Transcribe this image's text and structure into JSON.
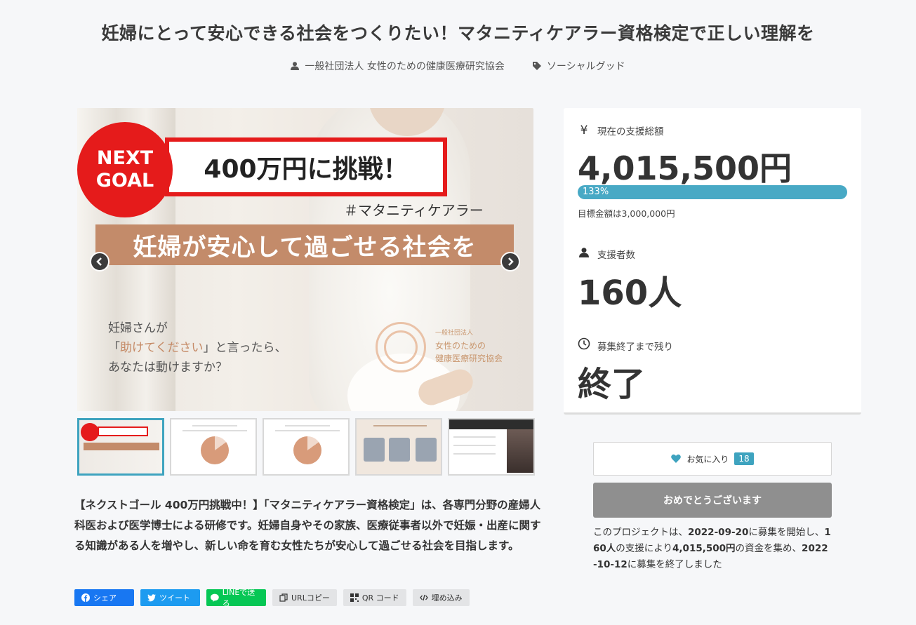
{
  "page": {
    "title": "妊婦にとって安心できる社会をつくりたい！マタニティケアラー資格検定で正しい理解を",
    "organizer": "一般社団法人 女性のための健康医療研究協会",
    "category": "ソーシャルグッド",
    "organizer_icon": "user-icon",
    "category_icon": "tag-icon"
  },
  "hero": {
    "goal_badge_line1": "NEXT",
    "goal_badge_line2": "GOAL",
    "goal_text": "400万円に挑戦！",
    "hashtag": "＃マタニティケアラー",
    "band_text": "妊婦が安心して過ごせる社会を",
    "copy_line1": "妊婦さんが",
    "copy_line2_quote_open": "「",
    "copy_line2_accent": "助けてください",
    "copy_line2_rest": "」と言ったら、",
    "copy_line3": "あなたは動けますか？",
    "logo_line1": "一般社団法人",
    "logo_line2": "女性のための",
    "logo_line3": "健康医療研究協会"
  },
  "description": "【ネクストゴール 400万円挑戦中！】「マタニティケアラー資格検定」は、各専門分野の産婦人科医および医学博士による研修です。妊婦自身やその家族、医療従事者以外で妊娠・出産に関する知識がある人を増やし、新しい命を育む女性たちが安心して過ごせる社会を目指します。",
  "share": {
    "facebook": "シェア",
    "twitter": "ツイート",
    "line": "LINEで送る",
    "url_copy": "URLコピー",
    "qr": "QR コード",
    "embed": "埋め込み"
  },
  "stats": {
    "total_label": "現在の支援総額",
    "total_icon": "yen",
    "total_value": "4,015,500円",
    "progress_text": "133%",
    "progress_fraction": 1.33,
    "goal_text": "目標金額は3,000,000円",
    "backers_label": "支援者数",
    "backers_value": "160人",
    "remaining_label": "募集終了まで残り",
    "remaining_value": "終了"
  },
  "actions": {
    "favorite_label": "お気に入り",
    "favorite_count": "18",
    "done_label": "おめでとうございます"
  },
  "summary": {
    "p1": "このプロジェクトは、",
    "start_date": "2022-09-20",
    "p2": "に募集を開始し、",
    "backers": "160人",
    "p3": "の支援により",
    "amount": "4,015,500円",
    "p4": "の資金を集め、",
    "end_date": "2022-10-12",
    "p5": "に募集を終了しました"
  },
  "colors": {
    "accent": "#3ea3bf",
    "progress": "#48a9c5",
    "goal_red": "#e51b1b",
    "band_brown": "#c38b6a"
  }
}
